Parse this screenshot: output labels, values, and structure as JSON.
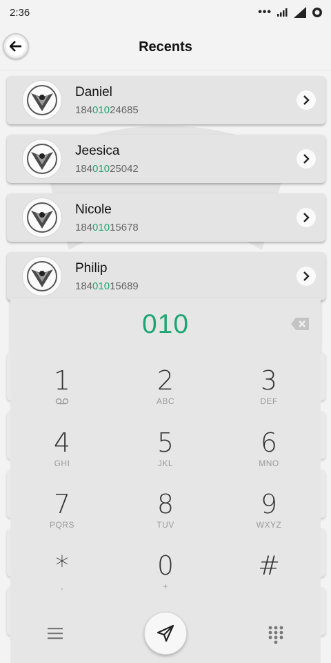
{
  "status": {
    "time": "2:36"
  },
  "header": {
    "title": "Recents"
  },
  "recents": [
    {
      "name": "Daniel",
      "number_prefix": "184",
      "number_match": "010",
      "number_suffix": "24685"
    },
    {
      "name": "Jeesica",
      "number_prefix": "184",
      "number_match": "010",
      "number_suffix": "25042"
    },
    {
      "name": "Nicole",
      "number_prefix": "184",
      "number_match": "010",
      "number_suffix": "15678"
    },
    {
      "name": "Philip",
      "number_prefix": "184",
      "number_match": "010",
      "number_suffix": "15689"
    }
  ],
  "dialer": {
    "value": "010",
    "keys": [
      {
        "digit": "1",
        "letters": ""
      },
      {
        "digit": "2",
        "letters": "ABC"
      },
      {
        "digit": "3",
        "letters": "DEF"
      },
      {
        "digit": "4",
        "letters": "GHI"
      },
      {
        "digit": "5",
        "letters": "JKL"
      },
      {
        "digit": "6",
        "letters": "MNO"
      },
      {
        "digit": "7",
        "letters": "PQRS"
      },
      {
        "digit": "8",
        "letters": "TUV"
      },
      {
        "digit": "9",
        "letters": "WXYZ"
      },
      {
        "digit": "*",
        "letters": ","
      },
      {
        "digit": "0",
        "letters": "+"
      },
      {
        "digit": "#",
        "letters": ""
      }
    ]
  },
  "colors": {
    "accent": "#1ea672",
    "card": "#e4e4e4",
    "panel": "#e6e6e6"
  },
  "icons": {
    "back": "arrow-left-icon",
    "chevron": "chevron-right-icon",
    "backspace": "backspace-icon",
    "voicemail": "voicemail-icon",
    "menu": "menu-icon",
    "call": "send-icon",
    "dialpad": "dialpad-icon"
  }
}
